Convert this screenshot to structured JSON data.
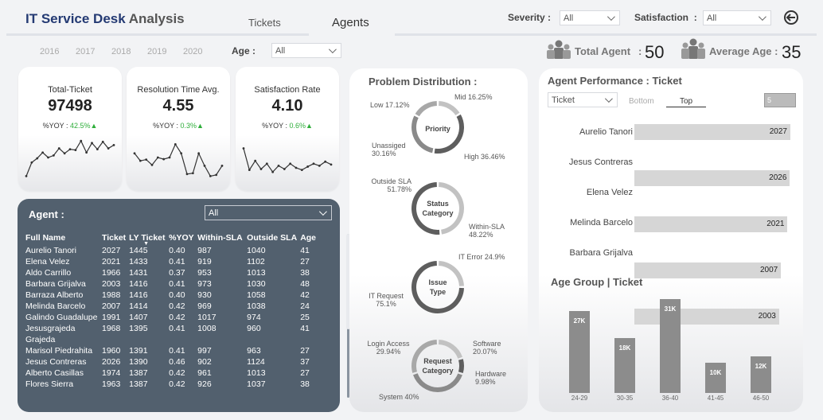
{
  "header": {
    "title": "IT Service Desk",
    "subtitle": "Analysis",
    "tabs": [
      "Tickets",
      "Agents"
    ],
    "severity_label": "Severity",
    "severity_value": "All",
    "satisfaction_label": "Satisfaction",
    "satisfaction_value": "All",
    "years": [
      "2016",
      "2017",
      "2018",
      "2019",
      "2020"
    ],
    "age_label": "Age :",
    "age_value": "All",
    "colon": ":"
  },
  "stats": {
    "total_agent_label": "Total Agent",
    "total_agent_value": "50",
    "average_age_label": "Average Age :",
    "average_age_value": "35",
    "colon": ":"
  },
  "kpis": [
    {
      "title": "Total-Ticket",
      "value": "97498",
      "yoy_label": "%YOY :",
      "yoy_value": "42.5%▲"
    },
    {
      "title": "Resolution Time Avg.",
      "value": "4.55",
      "yoy_label": "%YOY :",
      "yoy_value": "0.3%▲"
    },
    {
      "title": "Satisfaction Rate",
      "value": "4.10",
      "yoy_label": "%YOY :",
      "yoy_value": "0.6%▲"
    }
  ],
  "sparklines": [
    [
      0.05,
      0.38,
      0.48,
      0.62,
      0.5,
      0.55,
      0.72,
      0.6,
      0.7,
      0.68,
      0.9,
      0.62,
      0.85,
      0.7,
      0.88,
      0.72,
      0.8
    ],
    [
      0.6,
      0.42,
      0.45,
      0.32,
      0.5,
      0.46,
      0.5,
      0.82,
      0.6,
      0.1,
      0.12,
      0.6,
      0.3,
      0.05,
      0.08,
      0.3
    ],
    [
      0.72,
      0.2,
      0.42,
      0.22,
      0.35,
      0.15,
      0.3,
      0.22,
      0.35,
      0.25,
      0.2,
      0.28,
      0.35,
      0.3,
      0.4,
      0.33
    ]
  ],
  "agent_table": {
    "title": "Agent :",
    "filter_value": "All",
    "columns": [
      "Full Name",
      "Ticket",
      "LY Ticket",
      "%YOY",
      "Within-SLA",
      "Outside SLA",
      "Age"
    ],
    "rows": [
      [
        "Aurelio Tanori",
        "2027",
        "1445",
        "0.40",
        "987",
        "1040",
        "41"
      ],
      [
        "Elena Velez",
        "2021",
        "1433",
        "0.41",
        "919",
        "1102",
        "27"
      ],
      [
        "Aldo Carrillo",
        "1966",
        "1431",
        "0.37",
        "953",
        "1013",
        "38"
      ],
      [
        "Barbara Grijalva",
        "2003",
        "1416",
        "0.41",
        "973",
        "1030",
        "48"
      ],
      [
        "Barraza Alberto",
        "1988",
        "1416",
        "0.40",
        "930",
        "1058",
        "42"
      ],
      [
        "Melinda Barcelo",
        "2007",
        "1414",
        "0.42",
        "969",
        "1038",
        "24"
      ],
      [
        "Galindo Guadalupe",
        "1991",
        "1407",
        "0.42",
        "1017",
        "974",
        "25"
      ],
      [
        "Jesusgrajeda Grajeda",
        "1968",
        "1395",
        "0.41",
        "1008",
        "960",
        "41"
      ],
      [
        "Marisol Piedrahita",
        "1960",
        "1391",
        "0.41",
        "997",
        "963",
        "27"
      ],
      [
        "Jesus Contreras",
        "2026",
        "1390",
        "0.46",
        "902",
        "1124",
        "37"
      ],
      [
        "Alberto Casillas",
        "1974",
        "1387",
        "0.42",
        "961",
        "1013",
        "27"
      ],
      [
        "Flores Sierra",
        "1963",
        "1387",
        "0.42",
        "926",
        "1037",
        "38"
      ]
    ]
  },
  "problem_distribution": {
    "title": "Problem Distribution :",
    "donuts": [
      {
        "name": "Priority",
        "segments": [
          {
            "label": "Mid",
            "value": 16.25,
            "text": "Mid 16.25%"
          },
          {
            "label": "High",
            "value": 36.46,
            "text": "High 36.46%"
          },
          {
            "label": "Unassiged",
            "value": 30.16,
            "text": "Unassiged 30.16%"
          },
          {
            "label": "Low",
            "value": 17.12,
            "text": "Low 17.12%"
          }
        ]
      },
      {
        "name": "Status Category",
        "segments": [
          {
            "label": "Within-SLA",
            "value": 48.22,
            "text": "Within-SLA 48.22%"
          },
          {
            "label": "Outside SLA",
            "value": 51.78,
            "text": "Outside SLA 51.78%"
          }
        ]
      },
      {
        "name": "Issue Type",
        "segments": [
          {
            "label": "IT Error",
            "value": 24.9,
            "text": "IT Error 24.9%"
          },
          {
            "label": "IT Request",
            "value": 75.1,
            "text": "IT Request 75.1%"
          }
        ]
      },
      {
        "name": "Request Category",
        "segments": [
          {
            "label": "Software",
            "value": 20.07,
            "text": "Software 20.07%"
          },
          {
            "label": "Hardware",
            "value": 9.98,
            "text": "Hardware 9.98%"
          },
          {
            "label": "System",
            "value": 40,
            "text": "System 40%"
          },
          {
            "label": "Login Access",
            "value": 29.94,
            "text": "Login Access 29.94%"
          }
        ]
      }
    ]
  },
  "agent_performance": {
    "title": "Agent Performance : Ticket",
    "metric_value": "Ticket",
    "bottom_label": "Bottom",
    "top_label": "Top",
    "n_value": "5",
    "agents": [
      {
        "name": "Aurelio Tanori",
        "value": "2027"
      },
      {
        "name": "Jesus Contreras",
        "value": "2026"
      },
      {
        "name": "Elena Velez",
        "value": "2021"
      },
      {
        "name": "Melinda Barcelo",
        "value": "2007"
      },
      {
        "name": "Barbara Grijalva",
        "value": "2003"
      }
    ]
  },
  "age_group": {
    "title": "Age Group | Ticket"
  },
  "chart_data": {
    "type": "bar",
    "title": "Age Group | Ticket",
    "categories": [
      "24-29",
      "30-35",
      "36-40",
      "41-45",
      "46-50"
    ],
    "values": [
      27,
      18,
      31,
      10,
      12
    ],
    "value_labels": [
      "27K",
      "18K",
      "31K",
      "10K",
      "12K"
    ],
    "ylim": [
      0,
      31
    ],
    "grid": false
  }
}
